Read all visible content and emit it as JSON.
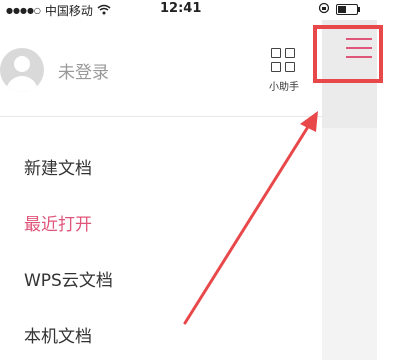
{
  "status_bar": {
    "carrier": "中国移动",
    "wifi_icon": "wifi-icon",
    "time": "12:41",
    "orientation_lock_icon": "orientation-lock-icon",
    "battery_icon": "battery-icon"
  },
  "header": {
    "login_status": "未登录",
    "assistant_label": "小助手",
    "avatar_icon": "user-avatar-icon",
    "assistant_icon": "grid-icon"
  },
  "menu": {
    "items": [
      {
        "label": "新建文档"
      },
      {
        "label": "最近打开"
      },
      {
        "label": "WPS云文档"
      },
      {
        "label": "本机文档"
      }
    ]
  },
  "hamburger": {
    "icon": "hamburger-icon",
    "accent_color": "#e0557a",
    "highlight_color": "#e8484a"
  },
  "colors": {
    "accent": "#e0557a",
    "annotation": "#e8484a",
    "text": "#333333",
    "muted": "#999999"
  }
}
